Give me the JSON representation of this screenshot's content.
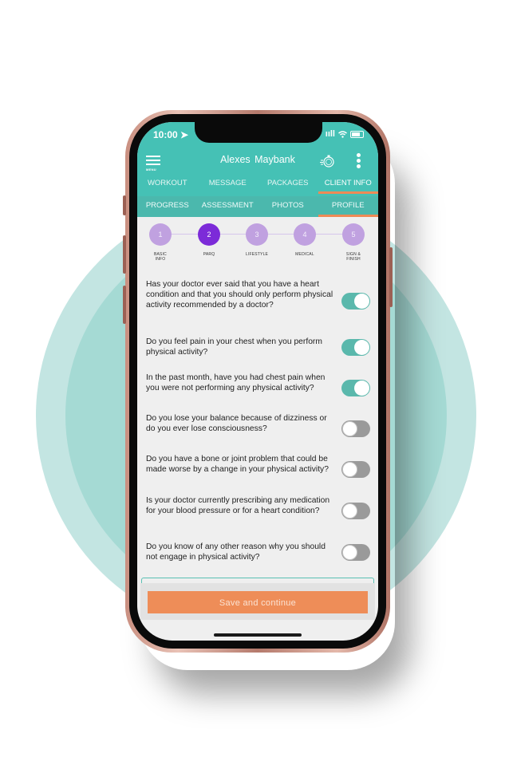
{
  "status_bar": {
    "time": "10:00",
    "signal": "ııll"
  },
  "header": {
    "menu_label": "MENU",
    "title": "Alexes  Maybank"
  },
  "tabs_primary": [
    {
      "label": "WORKOUT",
      "active": false
    },
    {
      "label": "MESSAGE",
      "active": false
    },
    {
      "label": "PACKAGES",
      "active": false
    },
    {
      "label": "CLIENT INFO",
      "active": true
    }
  ],
  "tabs_secondary": [
    {
      "label": "PROGRESS",
      "active": false
    },
    {
      "label": "ASSESSMENT",
      "active": false
    },
    {
      "label": "PHOTOS",
      "active": false
    },
    {
      "label": "PROFILE",
      "active": true
    }
  ],
  "stepper": [
    {
      "num": "1",
      "label_line1": "BASIC",
      "label_line2": "INFO",
      "active": false
    },
    {
      "num": "2",
      "label_line1": "PARQ",
      "label_line2": "",
      "active": true
    },
    {
      "num": "3",
      "label_line1": "LIFESTYLE",
      "label_line2": "",
      "active": false
    },
    {
      "num": "4",
      "label_line1": "MEDICAL",
      "label_line2": "",
      "active": false
    },
    {
      "num": "5",
      "label_line1": "SIGN &",
      "label_line2": "FINISH",
      "active": false
    }
  ],
  "questions": [
    {
      "text": "Has your doctor ever said that you have a heart condition and that you should only perform physical activity recommended by a doctor?",
      "answer": true
    },
    {
      "text": "Do you feel pain in your chest when you perform physical activity?",
      "answer": true
    },
    {
      "text": "In the past month, have you had chest pain when you were not performing any physical activity?",
      "answer": true
    },
    {
      "text": "Do you lose your balance because of dizziness or do you ever lose consciousness?",
      "answer": false
    },
    {
      "text": "Do you have a bone or joint problem that could be made worse by a change in your physical activity?",
      "answer": false
    },
    {
      "text": "Is your doctor currently prescribing any medication for your blood pressure or for a heart condition?",
      "answer": false
    },
    {
      "text": "Do you know of any other reason why you should not engage in physical activity?",
      "answer": false
    }
  ],
  "footer": {
    "save_label": "Save and continue"
  },
  "colors": {
    "teal": "#45c1b5",
    "accent_orange": "#ee8d58",
    "step_active": "#7c2bd8",
    "step_inactive": "#c0a1e0",
    "toggle_on": "#5ab8ac",
    "toggle_off": "#9a9a9a"
  }
}
